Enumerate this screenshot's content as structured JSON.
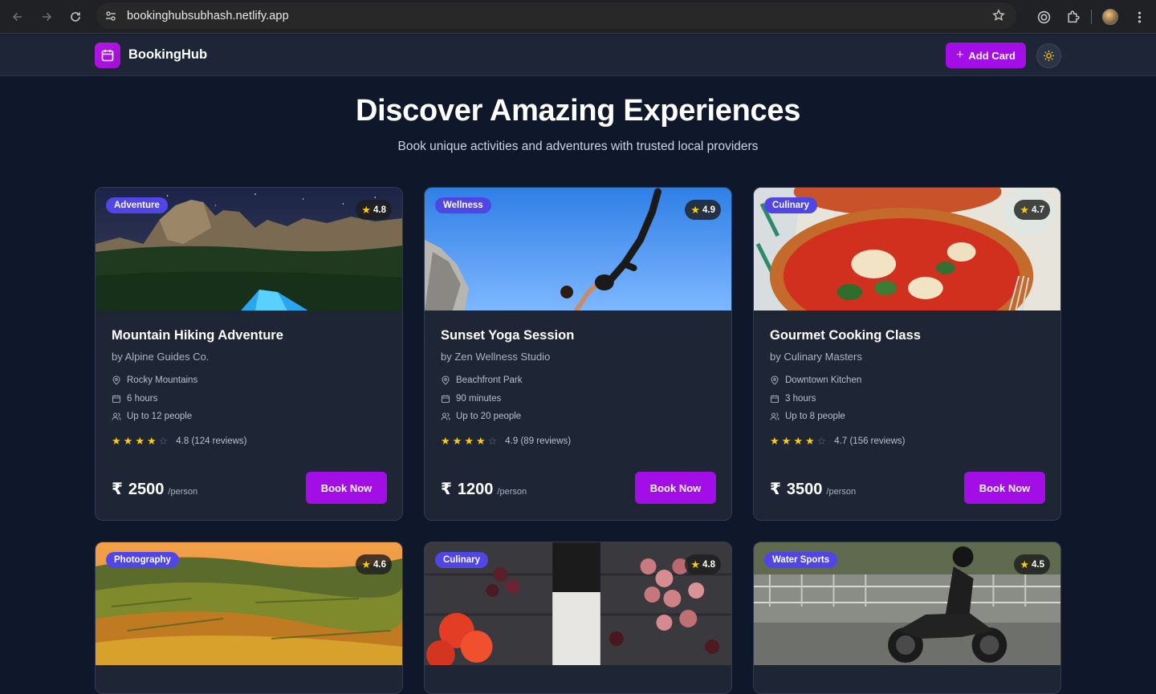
{
  "browser": {
    "url": "bookinghubsubhash.netlify.app"
  },
  "header": {
    "brand": "BookingHub",
    "add_card_label": "Add Card",
    "brand_color": "#a30ee6"
  },
  "hero": {
    "title": "Discover Amazing Experiences",
    "subtitle": "Book unique activities and adventures with trusted local providers"
  },
  "cards": [
    {
      "category": "Adventure",
      "rating": "4.8",
      "title": "Mountain Hiking Adventure",
      "provider": "by Alpine Guides Co.",
      "location": "Rocky Mountains",
      "duration": "6 hours",
      "capacity": "Up to 12 people",
      "reviews": "4.8 (124 reviews)",
      "filled_stars": 4,
      "currency": "₹",
      "price": "2500",
      "per": "/person",
      "cta": "Book Now"
    },
    {
      "category": "Wellness",
      "rating": "4.9",
      "title": "Sunset Yoga Session",
      "provider": "by Zen Wellness Studio",
      "location": "Beachfront Park",
      "duration": "90 minutes",
      "capacity": "Up to 20 people",
      "reviews": "4.9 (89 reviews)",
      "filled_stars": 4,
      "currency": "₹",
      "price": "1200",
      "per": "/person",
      "cta": "Book Now"
    },
    {
      "category": "Culinary",
      "rating": "4.7",
      "title": "Gourmet Cooking Class",
      "provider": "by Culinary Masters",
      "location": "Downtown Kitchen",
      "duration": "3 hours",
      "capacity": "Up to 8 people",
      "reviews": "4.7 (156 reviews)",
      "filled_stars": 4,
      "currency": "₹",
      "price": "3500",
      "per": "/person",
      "cta": "Book Now"
    },
    {
      "category": "Photography",
      "rating": "4.6"
    },
    {
      "category": "Culinary",
      "rating": "4.8"
    },
    {
      "category": "Water Sports",
      "rating": "4.5"
    }
  ]
}
